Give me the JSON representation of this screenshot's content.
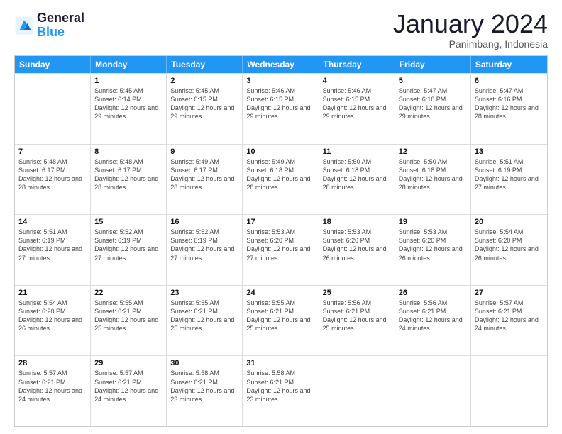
{
  "logo": {
    "line1": "General",
    "line2": "Blue"
  },
  "title": "January 2024",
  "subtitle": "Panimbang, Indonesia",
  "days": [
    "Sunday",
    "Monday",
    "Tuesday",
    "Wednesday",
    "Thursday",
    "Friday",
    "Saturday"
  ],
  "rows": [
    [
      {
        "day": "",
        "info": ""
      },
      {
        "day": "1",
        "info": "Sunrise: 5:45 AM\nSunset: 6:14 PM\nDaylight: 12 hours\nand 29 minutes."
      },
      {
        "day": "2",
        "info": "Sunrise: 5:45 AM\nSunset: 6:15 PM\nDaylight: 12 hours\nand 29 minutes."
      },
      {
        "day": "3",
        "info": "Sunrise: 5:46 AM\nSunset: 6:15 PM\nDaylight: 12 hours\nand 29 minutes."
      },
      {
        "day": "4",
        "info": "Sunrise: 5:46 AM\nSunset: 6:15 PM\nDaylight: 12 hours\nand 29 minutes."
      },
      {
        "day": "5",
        "info": "Sunrise: 5:47 AM\nSunset: 6:16 PM\nDaylight: 12 hours\nand 29 minutes."
      },
      {
        "day": "6",
        "info": "Sunrise: 5:47 AM\nSunset: 6:16 PM\nDaylight: 12 hours\nand 28 minutes."
      }
    ],
    [
      {
        "day": "7",
        "info": "Sunrise: 5:48 AM\nSunset: 6:17 PM\nDaylight: 12 hours\nand 28 minutes."
      },
      {
        "day": "8",
        "info": "Sunrise: 5:48 AM\nSunset: 6:17 PM\nDaylight: 12 hours\nand 28 minutes."
      },
      {
        "day": "9",
        "info": "Sunrise: 5:49 AM\nSunset: 6:17 PM\nDaylight: 12 hours\nand 28 minutes."
      },
      {
        "day": "10",
        "info": "Sunrise: 5:49 AM\nSunset: 6:18 PM\nDaylight: 12 hours\nand 28 minutes."
      },
      {
        "day": "11",
        "info": "Sunrise: 5:50 AM\nSunset: 6:18 PM\nDaylight: 12 hours\nand 28 minutes."
      },
      {
        "day": "12",
        "info": "Sunrise: 5:50 AM\nSunset: 6:18 PM\nDaylight: 12 hours\nand 28 minutes."
      },
      {
        "day": "13",
        "info": "Sunrise: 5:51 AM\nSunset: 6:19 PM\nDaylight: 12 hours\nand 27 minutes."
      }
    ],
    [
      {
        "day": "14",
        "info": "Sunrise: 5:51 AM\nSunset: 6:19 PM\nDaylight: 12 hours\nand 27 minutes."
      },
      {
        "day": "15",
        "info": "Sunrise: 5:52 AM\nSunset: 6:19 PM\nDaylight: 12 hours\nand 27 minutes."
      },
      {
        "day": "16",
        "info": "Sunrise: 5:52 AM\nSunset: 6:19 PM\nDaylight: 12 hours\nand 27 minutes."
      },
      {
        "day": "17",
        "info": "Sunrise: 5:53 AM\nSunset: 6:20 PM\nDaylight: 12 hours\nand 27 minutes."
      },
      {
        "day": "18",
        "info": "Sunrise: 5:53 AM\nSunset: 6:20 PM\nDaylight: 12 hours\nand 26 minutes."
      },
      {
        "day": "19",
        "info": "Sunrise: 5:53 AM\nSunset: 6:20 PM\nDaylight: 12 hours\nand 26 minutes."
      },
      {
        "day": "20",
        "info": "Sunrise: 5:54 AM\nSunset: 6:20 PM\nDaylight: 12 hours\nand 26 minutes."
      }
    ],
    [
      {
        "day": "21",
        "info": "Sunrise: 5:54 AM\nSunset: 6:20 PM\nDaylight: 12 hours\nand 26 minutes."
      },
      {
        "day": "22",
        "info": "Sunrise: 5:55 AM\nSunset: 6:21 PM\nDaylight: 12 hours\nand 25 minutes."
      },
      {
        "day": "23",
        "info": "Sunrise: 5:55 AM\nSunset: 6:21 PM\nDaylight: 12 hours\nand 25 minutes."
      },
      {
        "day": "24",
        "info": "Sunrise: 5:55 AM\nSunset: 6:21 PM\nDaylight: 12 hours\nand 25 minutes."
      },
      {
        "day": "25",
        "info": "Sunrise: 5:56 AM\nSunset: 6:21 PM\nDaylight: 12 hours\nand 25 minutes."
      },
      {
        "day": "26",
        "info": "Sunrise: 5:56 AM\nSunset: 6:21 PM\nDaylight: 12 hours\nand 24 minutes."
      },
      {
        "day": "27",
        "info": "Sunrise: 5:57 AM\nSunset: 6:21 PM\nDaylight: 12 hours\nand 24 minutes."
      }
    ],
    [
      {
        "day": "28",
        "info": "Sunrise: 5:57 AM\nSunset: 6:21 PM\nDaylight: 12 hours\nand 24 minutes."
      },
      {
        "day": "29",
        "info": "Sunrise: 5:57 AM\nSunset: 6:21 PM\nDaylight: 12 hours\nand 24 minutes."
      },
      {
        "day": "30",
        "info": "Sunrise: 5:58 AM\nSunset: 6:21 PM\nDaylight: 12 hours\nand 23 minutes."
      },
      {
        "day": "31",
        "info": "Sunrise: 5:58 AM\nSunset: 6:21 PM\nDaylight: 12 hours\nand 23 minutes."
      },
      {
        "day": "",
        "info": ""
      },
      {
        "day": "",
        "info": ""
      },
      {
        "day": "",
        "info": ""
      }
    ]
  ]
}
